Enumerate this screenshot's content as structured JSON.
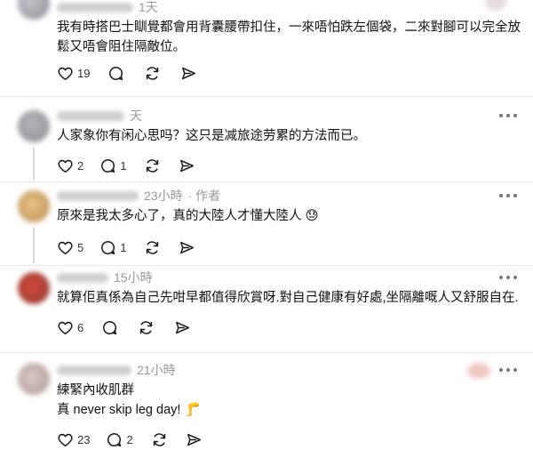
{
  "comments": [
    {
      "time": "1天",
      "text": "我有時搭巴士瞓覺都會用背囊腰帶扣住，一來唔怕跌左個袋，二來對腳可以完全放\n鬆又唔會阻住隔敵位。",
      "likes": "19",
      "replies": "",
      "author_tag": ""
    },
    {
      "time": "天",
      "text": "人家象你有闲心思吗？这只是减旅途劳累的方法而已。",
      "likes": "2",
      "replies": "1",
      "author_tag": ""
    },
    {
      "time": "23小時",
      "text": "原來是我太多心了，真的大陸人才懂大陸人 😓",
      "likes": "5",
      "replies": "1",
      "author_tag": "· 作者"
    },
    {
      "time": "15小時",
      "text": "就算佢真係為自己先咁早都值得欣賞呀.對自己健康有好處,坐隔離嘅人又舒服自在.",
      "likes": "6",
      "replies": "",
      "author_tag": ""
    },
    {
      "time": "21小時",
      "text": "練緊內收肌群\n真 never skip leg day! 🦵",
      "likes": "23",
      "replies": "2",
      "author_tag": ""
    }
  ],
  "icons": {
    "like": "heart-icon",
    "reply": "comment-icon",
    "repost": "repost-icon",
    "share": "send-icon",
    "more": "more-options-icon"
  },
  "colors": {
    "text": "#101010",
    "muted": "#999999",
    "divider": "#e6e6e6",
    "icon": "#1a1a1a"
  }
}
